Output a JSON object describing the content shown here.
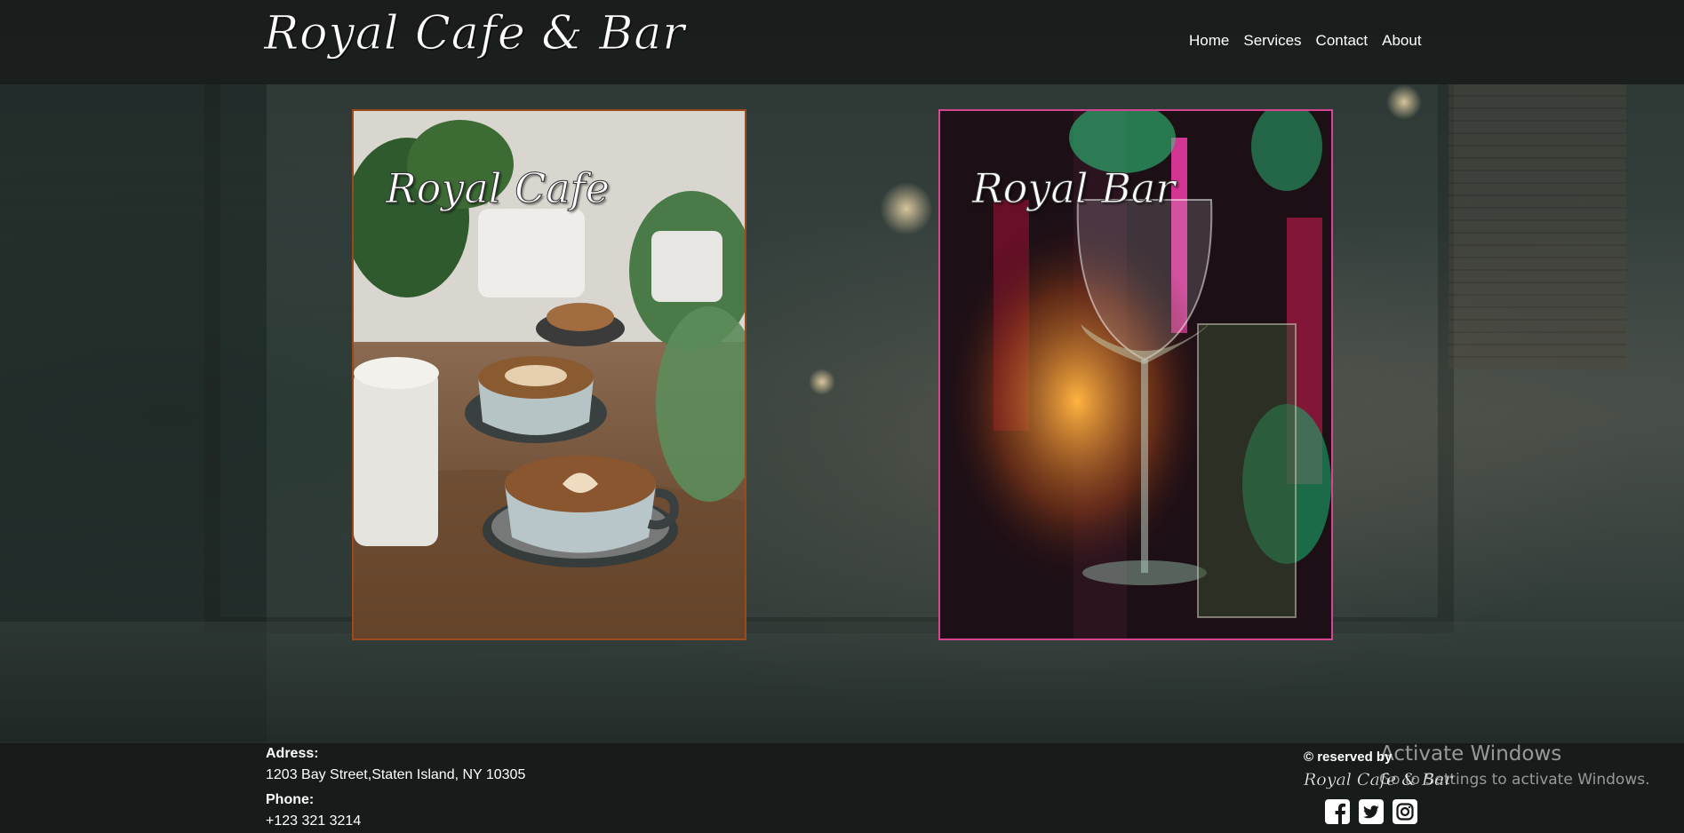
{
  "header": {
    "logo": "Royal Cafe & Bar",
    "nav": [
      "Home",
      "Services",
      "Contact",
      "About"
    ]
  },
  "cards": {
    "cafe": {
      "title": "Royal Cafe",
      "border_color": "#9c4a1c"
    },
    "bar": {
      "title": "Royal Bar",
      "border_color": "#d6458f"
    }
  },
  "footer": {
    "address_label": "Adress:",
    "address_value": "1203 Bay Street,Staten Island, NY 10305",
    "phone_label": "Phone:",
    "phone_value": "+123 321 3214",
    "reserved": "© reserved by",
    "logo": "Royal Cafe & Bar",
    "socials": [
      "facebook-icon",
      "twitter-icon",
      "instagram-icon"
    ]
  },
  "os_overlay": {
    "title": "Activate Windows",
    "subtitle": "Go to Settings to activate Windows."
  }
}
